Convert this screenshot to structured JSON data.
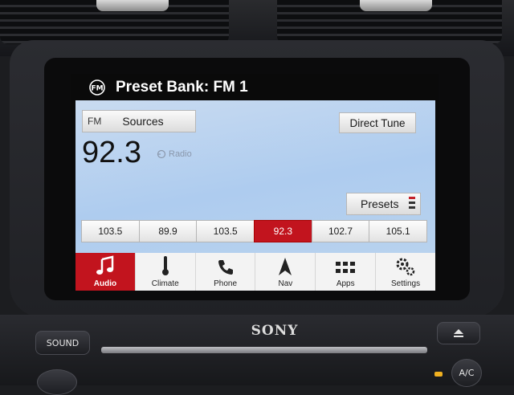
{
  "header": {
    "title": "Preset Bank: FM 1"
  },
  "source": {
    "band": "FM",
    "sources_label": "Sources",
    "direct_tune_label": "Direct Tune"
  },
  "now_playing": {
    "frequency": "92.3",
    "hd_label": "Radio"
  },
  "presets_label": "Presets",
  "presets": [
    {
      "label": "103.5",
      "active": false
    },
    {
      "label": "89.9",
      "active": false
    },
    {
      "label": "103.5",
      "active": false
    },
    {
      "label": "92.3",
      "active": true
    },
    {
      "label": "102.7",
      "active": false
    },
    {
      "label": "105.1",
      "active": false
    }
  ],
  "nav": [
    {
      "label": "Audio",
      "icon": "music-note-icon",
      "active": true
    },
    {
      "label": "Climate",
      "icon": "thermometer-icon",
      "active": false
    },
    {
      "label": "Phone",
      "icon": "phone-icon",
      "active": false
    },
    {
      "label": "Nav",
      "icon": "nav-arrow-icon",
      "active": false
    },
    {
      "label": "Apps",
      "icon": "apps-grid-icon",
      "active": false
    },
    {
      "label": "Settings",
      "icon": "gears-icon",
      "active": false
    }
  ],
  "hardware": {
    "brand": "SONY",
    "sound_label": "SOUND",
    "ac_label": "A/C"
  },
  "colors": {
    "accent_red": "#c2141e",
    "screen_bg": "#b8d2ee"
  }
}
